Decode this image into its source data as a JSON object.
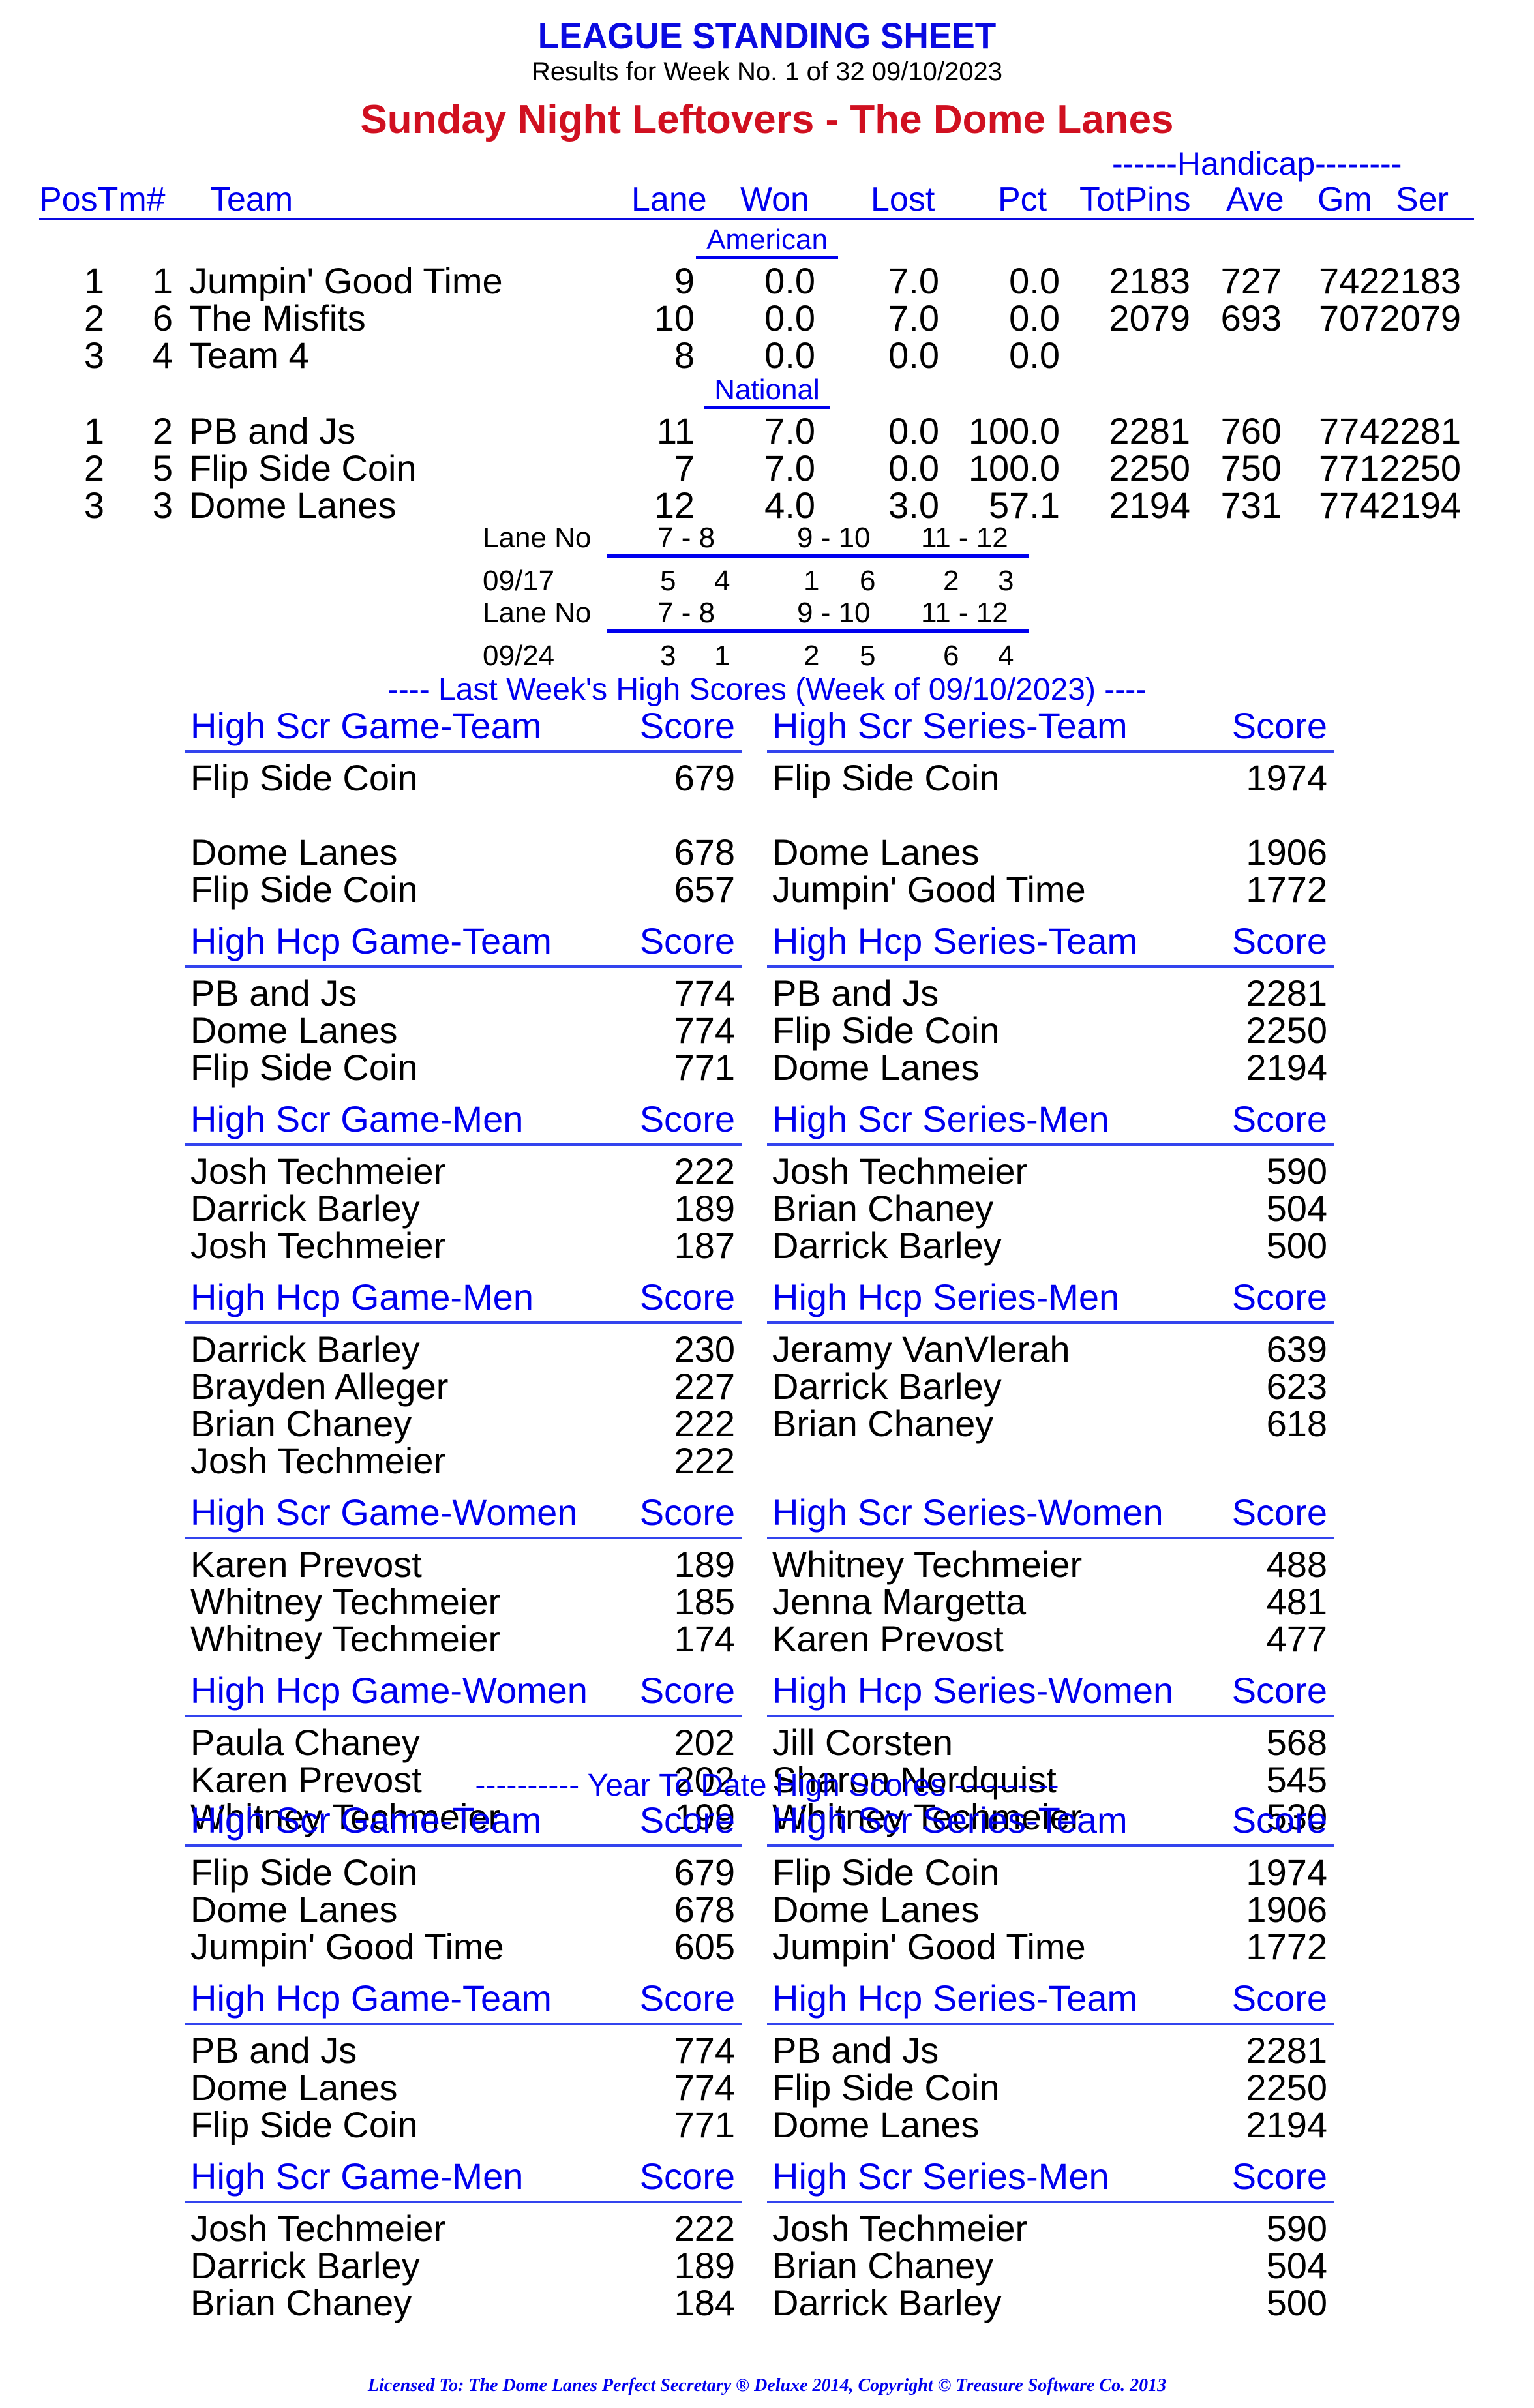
{
  "header": {
    "title": "LEAGUE STANDING SHEET",
    "subtitle": "Results for Week No. 1 of 32    09/10/2023",
    "league": "Sunday Night Leftovers - The Dome Lanes",
    "handicap_label": "------Handicap--------"
  },
  "columns": {
    "pos_tm": "PosTm#",
    "team": "Team",
    "lane": "Lane",
    "won": "Won",
    "lost": "Lost",
    "pct": "Pct",
    "totpins": "TotPins",
    "ave": "Ave",
    "gm": "Gm",
    "ser": "Ser"
  },
  "divisions": [
    {
      "name": "American",
      "rows": [
        {
          "pos": "1",
          "tm": "1",
          "team": "Jumpin' Good Time",
          "lane": "9",
          "won": "0.0",
          "lost": "7.0",
          "pct": "0.0",
          "totpins": "2183",
          "ave": "727",
          "gmser": "7422183"
        },
        {
          "pos": "2",
          "tm": "6",
          "team": "The Misfits",
          "lane": "10",
          "won": "0.0",
          "lost": "7.0",
          "pct": "0.0",
          "totpins": "2079",
          "ave": "693",
          "gmser": "7072079"
        },
        {
          "pos": "3",
          "tm": "4",
          "team": "Team 4",
          "lane": "8",
          "won": "0.0",
          "lost": "0.0",
          "pct": "0.0",
          "totpins": "",
          "ave": "",
          "gmser": ""
        }
      ]
    },
    {
      "name": "National",
      "rows": [
        {
          "pos": "1",
          "tm": "2",
          "team": "PB and Js",
          "lane": "11",
          "won": "7.0",
          "lost": "0.0",
          "pct": "100.0",
          "totpins": "2281",
          "ave": "760",
          "gmser": "7742281"
        },
        {
          "pos": "2",
          "tm": "5",
          "team": "Flip Side Coin",
          "lane": "7",
          "won": "7.0",
          "lost": "0.0",
          "pct": "100.0",
          "totpins": "2250",
          "ave": "750",
          "gmser": "7712250"
        },
        {
          "pos": "3",
          "tm": "3",
          "team": "Dome Lanes",
          "lane": "12",
          "won": "4.0",
          "lost": "3.0",
          "pct": "57.1",
          "totpins": "2194",
          "ave": "731",
          "gmser": "7742194"
        }
      ]
    }
  ],
  "lane_assignments": [
    {
      "label": "Lane No",
      "pairs": [
        "7 -  8",
        "9 - 10",
        "11 - 12"
      ],
      "date": "09/17",
      "teams": [
        "5",
        "4",
        "1",
        "6",
        "2",
        "3"
      ]
    },
    {
      "label": "Lane No",
      "pairs": [
        "7 -  8",
        "9 - 10",
        "11 - 12"
      ],
      "date": "09/24",
      "teams": [
        "3",
        "1",
        "2",
        "5",
        "6",
        "4"
      ]
    }
  ],
  "last_week_title": "----  Last Week's High Scores   (Week of 09/10/2023)  ----",
  "ytd_title": "---------- Year To Date High Scores ----------",
  "score_label": "Score",
  "last_week": [
    {
      "left": {
        "title": "High Scr Game-Team",
        "rows": [
          [
            "Flip Side Coin",
            "679"
          ],
          [
            "",
            ""
          ],
          [
            "Dome Lanes",
            "678"
          ],
          [
            "Flip Side Coin",
            "657"
          ]
        ]
      },
      "right": {
        "title": "High Scr Series-Team",
        "rows": [
          [
            "Flip Side Coin",
            "1974"
          ],
          [
            "",
            ""
          ],
          [
            "Dome Lanes",
            "1906"
          ],
          [
            "Jumpin' Good Time",
            "1772"
          ]
        ]
      }
    },
    {
      "left": {
        "title": "High Hcp Game-Team",
        "rows": [
          [
            "PB and Js",
            "774"
          ],
          [
            "Dome Lanes",
            "774"
          ],
          [
            "Flip Side Coin",
            "771"
          ]
        ]
      },
      "right": {
        "title": "High Hcp Series-Team",
        "rows": [
          [
            "PB and Js",
            "2281"
          ],
          [
            "Flip Side Coin",
            "2250"
          ],
          [
            "Dome Lanes",
            "2194"
          ]
        ]
      }
    },
    {
      "left": {
        "title": "High Scr Game-Men",
        "rows": [
          [
            "Josh Techmeier",
            "222"
          ],
          [
            "Darrick Barley",
            "189"
          ],
          [
            "Josh Techmeier",
            "187"
          ]
        ]
      },
      "right": {
        "title": "High Scr Series-Men",
        "rows": [
          [
            "Josh Techmeier",
            "590"
          ],
          [
            "Brian Chaney",
            "504"
          ],
          [
            "Darrick Barley",
            "500"
          ]
        ]
      }
    },
    {
      "left": {
        "title": "High Hcp Game-Men",
        "rows": [
          [
            "Darrick Barley",
            "230"
          ],
          [
            "Brayden Alleger",
            "227"
          ],
          [
            "Brian Chaney",
            "222"
          ],
          [
            "Josh Techmeier",
            "222"
          ]
        ]
      },
      "right": {
        "title": "High Hcp Series-Men",
        "rows": [
          [
            "Jeramy VanVlerah",
            "639"
          ],
          [
            "Darrick Barley",
            "623"
          ],
          [
            "Brian Chaney",
            "618"
          ]
        ]
      }
    },
    {
      "left": {
        "title": "High Scr Game-Women",
        "rows": [
          [
            "Karen Prevost",
            "189"
          ],
          [
            "Whitney Techmeier",
            "185"
          ],
          [
            "Whitney Techmeier",
            "174"
          ]
        ]
      },
      "right": {
        "title": "High Scr Series-Women",
        "rows": [
          [
            "Whitney Techmeier",
            "488"
          ],
          [
            "Jenna Margetta",
            "481"
          ],
          [
            "Karen Prevost",
            "477"
          ]
        ]
      }
    },
    {
      "left": {
        "title": "High Hcp Game-Women",
        "rows": [
          [
            "Paula Chaney",
            "202"
          ],
          [
            "Karen Prevost",
            "202"
          ],
          [
            "Whitney Techmeier",
            "199"
          ]
        ]
      },
      "right": {
        "title": "High Hcp Series-Women",
        "rows": [
          [
            "Jill Corsten",
            "568"
          ],
          [
            "Sharon Nordquist",
            "545"
          ],
          [
            "Whitney Techmeier",
            "530"
          ]
        ]
      }
    }
  ],
  "ytd": [
    {
      "left": {
        "title": "High Scr Game-Team",
        "rows": [
          [
            "Flip Side Coin",
            "679"
          ],
          [
            "Dome Lanes",
            "678"
          ],
          [
            "Jumpin' Good Time",
            "605"
          ]
        ]
      },
      "right": {
        "title": "High Scr Series-Team",
        "rows": [
          [
            "Flip Side Coin",
            "1974"
          ],
          [
            "Dome Lanes",
            "1906"
          ],
          [
            "Jumpin' Good Time",
            "1772"
          ]
        ]
      }
    },
    {
      "left": {
        "title": "High Hcp Game-Team",
        "rows": [
          [
            "PB and Js",
            "774"
          ],
          [
            "Dome Lanes",
            "774"
          ],
          [
            "Flip Side Coin",
            "771"
          ]
        ]
      },
      "right": {
        "title": "High Hcp Series-Team",
        "rows": [
          [
            "PB and Js",
            "2281"
          ],
          [
            "Flip Side Coin",
            "2250"
          ],
          [
            "Dome Lanes",
            "2194"
          ]
        ]
      }
    },
    {
      "left": {
        "title": "High Scr Game-Men",
        "rows": [
          [
            "Josh Techmeier",
            "222"
          ],
          [
            "Darrick Barley",
            "189"
          ],
          [
            "Brian Chaney",
            "184"
          ]
        ]
      },
      "right": {
        "title": "High Scr Series-Men",
        "rows": [
          [
            "Josh Techmeier",
            "590"
          ],
          [
            "Brian Chaney",
            "504"
          ],
          [
            "Darrick Barley",
            "500"
          ]
        ]
      }
    }
  ],
  "footer": "Licensed To: The Dome Lanes     Perfect Secretary ® Deluxe  2014, Copyright © Treasure Software Co. 2013"
}
